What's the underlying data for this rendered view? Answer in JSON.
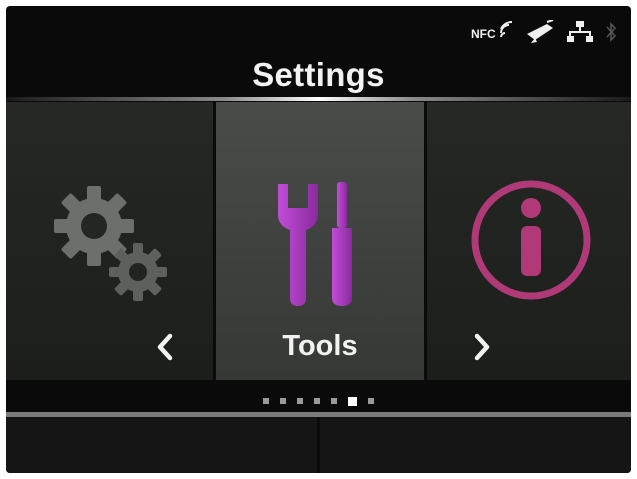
{
  "status_bar": {
    "nfc_label": "NFC",
    "icons": [
      "nfc-icon",
      "handheld-scanner-icon",
      "lan-icon",
      "bluetooth-icon"
    ]
  },
  "title": "Settings",
  "carousel": {
    "items": [
      {
        "name": "settings-gear",
        "icon": "gears-icon",
        "label": ""
      },
      {
        "name": "tools",
        "icon": "wrench-screwdriver-icon",
        "label": "Tools"
      },
      {
        "name": "information",
        "icon": "info-icon",
        "label": ""
      }
    ],
    "selected_index": 1
  },
  "pagination": {
    "count": 7,
    "active_index": 5
  },
  "colors": {
    "accent_purple": "#a23ab6",
    "info_pink": "#b03a78",
    "gear_gray": "#6d6f6c"
  },
  "softkeys": [
    "",
    ""
  ]
}
